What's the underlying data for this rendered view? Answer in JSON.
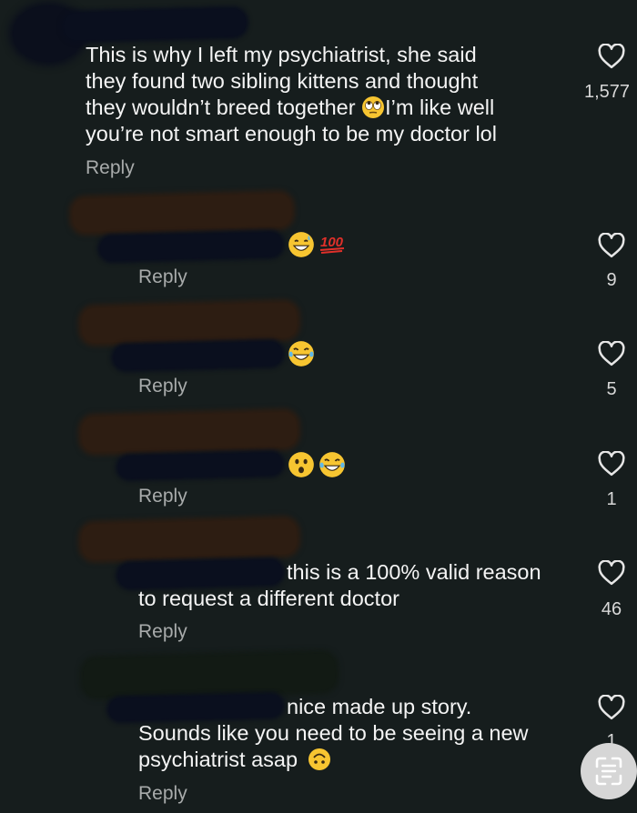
{
  "comments": [
    {
      "text_lines": [
        "This is why I left my psychiatrist, she said",
        "they found two sibling kittens and thought",
        "they wouldn’t breed together ",
        "I’m like well",
        "you’re not smart enough to be my doctor lol"
      ],
      "reply_label": "Reply",
      "like_count": "1,577",
      "emoji": [
        "rolling-eyes"
      ]
    },
    {
      "reply_label": "Reply",
      "like_count": "9",
      "emoji": [
        "grinning-sweat",
        "hundred-points"
      ]
    },
    {
      "reply_label": "Reply",
      "like_count": "5",
      "emoji": [
        "tears-of-joy"
      ]
    },
    {
      "reply_label": "Reply",
      "like_count": "1",
      "emoji": [
        "hushed-face",
        "tears-of-joy"
      ]
    },
    {
      "text_lines": [
        "this is a 100% valid reason",
        "to request a different doctor"
      ],
      "reply_label": "Reply",
      "like_count": "46"
    },
    {
      "text_lines": [
        "nice made up story.",
        "Sounds like you need to be seeing a new",
        "psychiatrist asap"
      ],
      "reply_label": "Reply",
      "like_count": "1",
      "emoji": [
        "upside-down-face"
      ]
    }
  ],
  "icons": {
    "like": "heart-outline-icon",
    "scan": "text-scan-icon"
  },
  "colors": {
    "background": "#161d1d",
    "text": "#f4f4f4",
    "muted": "#a8abab",
    "scribble_brown": "#2d1d12",
    "scribble_navy": "#0a0f1e"
  }
}
